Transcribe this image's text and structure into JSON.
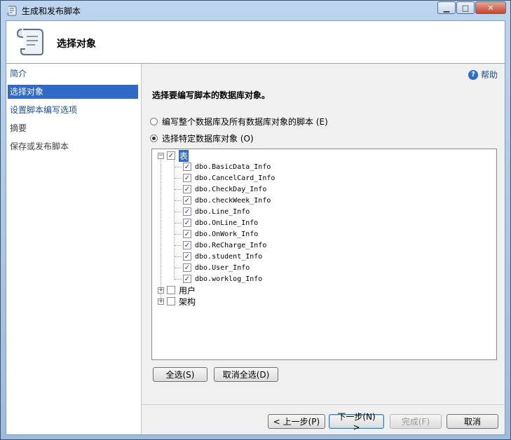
{
  "window": {
    "title": "生成和发布脚本",
    "controls": {
      "minimize": "▁",
      "maximize": "□",
      "close": "✕"
    }
  },
  "header": {
    "title": "选择对象"
  },
  "nav": {
    "items": [
      {
        "label": "简介",
        "state": "link"
      },
      {
        "label": "选择对象",
        "state": "selected"
      },
      {
        "label": "设置脚本编写选项",
        "state": "link"
      },
      {
        "label": "摘要",
        "state": "plain"
      },
      {
        "label": "保存或发布脚本",
        "state": "plain"
      }
    ]
  },
  "help": {
    "label": "帮助"
  },
  "content": {
    "instruction": "选择要编写脚本的数据库对象。",
    "radio_all": "编写整个数据库及所有数据库对象的脚本 (E)",
    "radio_specific": "选择特定数据库对象 (O)",
    "selected_radio": "specific"
  },
  "tree": {
    "root": {
      "label": "表",
      "checked": true,
      "expanded": true
    },
    "tables": [
      "dbo.BasicData_Info",
      "dbo.CancelCard_Info",
      "dbo.CheckDay_Info",
      "dbo.checkWeek_Info",
      "dbo.Line_Info",
      "dbo.OnLine_Info",
      "dbo.OnWork_Info",
      "dbo.ReCharge_Info",
      "dbo.student_Info",
      "dbo.User_Info",
      "dbo.worklog_Info"
    ],
    "users": {
      "label": "用户",
      "checked": false
    },
    "schemas": {
      "label": "架构",
      "checked": false
    }
  },
  "buttons": {
    "select_all": "全选(S)",
    "deselect_all": "取消全选(D)",
    "prev": "< 上一步(P)",
    "next": "下一步(N) >",
    "finish": "完成(F)",
    "cancel": "取消"
  }
}
